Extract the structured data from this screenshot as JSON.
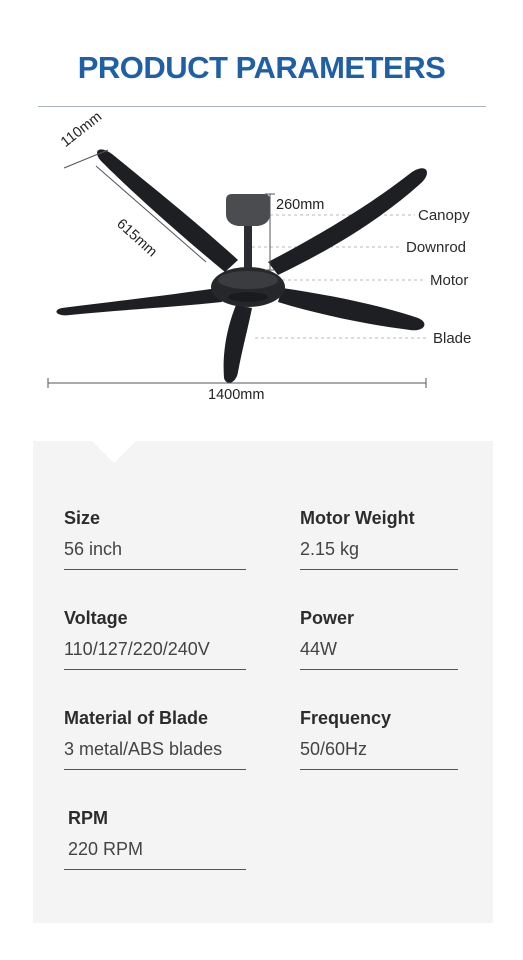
{
  "header": {
    "title": "PRODUCT PARAMETERS"
  },
  "diagram": {
    "dimensions": {
      "blade_width": "110mm",
      "blade_length": "615mm",
      "height": "260mm",
      "span": "1400mm"
    },
    "parts": [
      "Canopy",
      "Downrod",
      "Motor",
      "Blade"
    ],
    "colors": {
      "fan": "#1e1f22",
      "canopy": "#4a4c50",
      "dim_line": "#555555",
      "leader": "#b8b8b8"
    }
  },
  "specs": [
    {
      "label": "Size",
      "value": "56 inch"
    },
    {
      "label": "Motor Weight",
      "value": "2.15 kg"
    },
    {
      "label": "Voltage",
      "value": "110/127/220/240V"
    },
    {
      "label": "Power",
      "value": "44W"
    },
    {
      "label": "Material of Blade",
      "value": "3 metal/ABS blades"
    },
    {
      "label": "Frequency",
      "value": "50/60Hz"
    },
    {
      "label": "RPM",
      "value": "220 RPM"
    }
  ],
  "theme": {
    "accent": "#1f5fa5",
    "panel_bg": "#f4f4f4"
  }
}
